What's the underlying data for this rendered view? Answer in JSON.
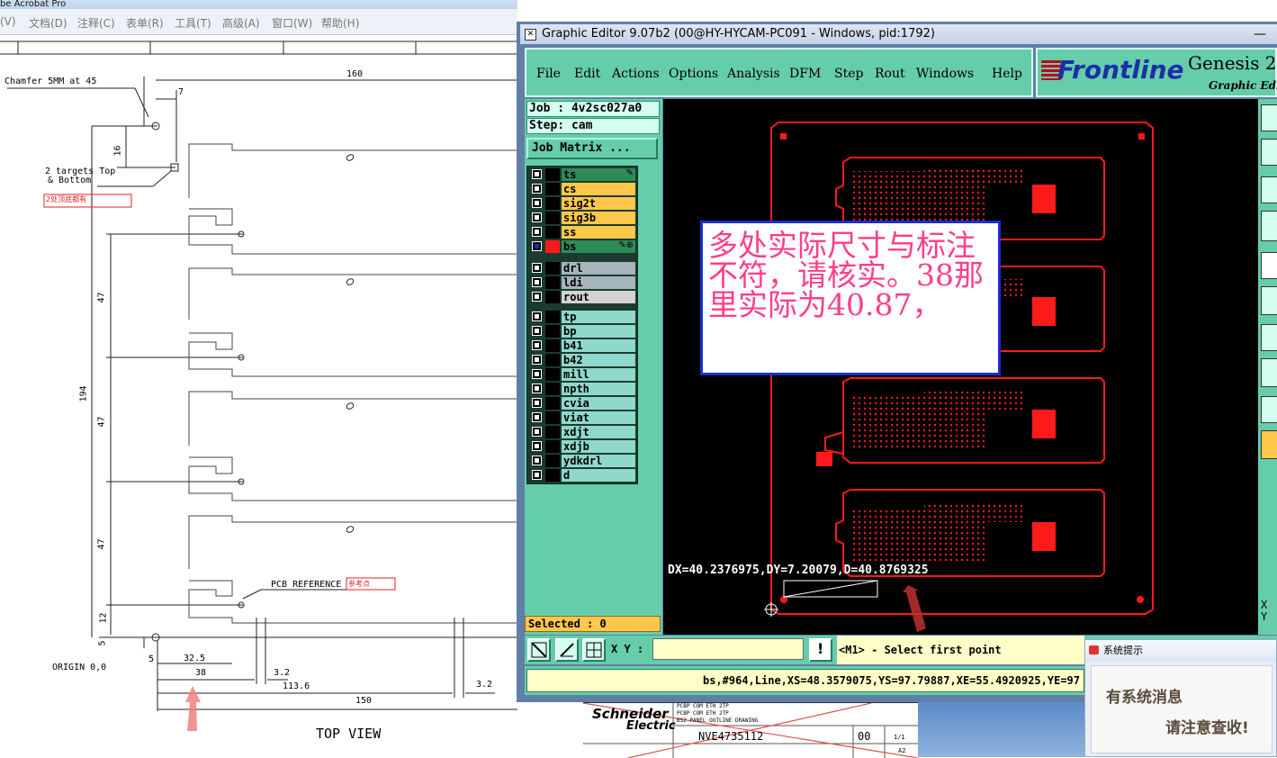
{
  "acrobat": {
    "title": "be Acrobat Pro",
    "menu": [
      "(V)",
      "文档(D)",
      "注释(C)",
      "表单(R)",
      "工具(T)",
      "高级(A)",
      "窗口(W)",
      "帮助(H)"
    ]
  },
  "drawing": {
    "chamfer": "Chamfer 5MM at 45",
    "targets_l1": "2 targets Top",
    "targets_l2": "& Bottom",
    "targets_note": "2处顶底都有",
    "pcb_ref": "PCB REFERENCE",
    "pcb_ref_note": "参考点",
    "origin": "ORIGIN 0,0",
    "top_view": "TOP VIEW",
    "dims": {
      "d160": "160",
      "d7": "7",
      "d16": "16",
      "d47a": "47",
      "d47b": "47",
      "d47c": "47",
      "d194": "194",
      "d12": "12",
      "d5v": "5",
      "d5h": "5",
      "d32_5": "32.5",
      "d38": "38",
      "d3_2a": "3.2",
      "d113_6": "113.6",
      "d3_2b": "3.2",
      "d150": "150"
    }
  },
  "genesis": {
    "title": "Graphic Editor 9.07b2 (00@HY-HYCAM-PC091 - Windows, pid:1792)",
    "menu": [
      "File",
      "Edit",
      "Actions",
      "Options",
      "Analysis",
      "DFM",
      "Step",
      "Rout",
      "Windows",
      "Help"
    ],
    "logo": "Frontline",
    "brand": "Genesis 2",
    "brand_sub": "Graphic Edit",
    "job_label": "Job : 4v2sc027a0",
    "step_label": "Step: cam",
    "job_matrix": "Job Matrix ...",
    "layers_group1": [
      {
        "name": "ts",
        "color": "#2e8b57",
        "mark": "✎"
      },
      {
        "name": "cs",
        "color": "#ffc84a"
      },
      {
        "name": "sig2t",
        "color": "#ffc84a"
      },
      {
        "name": "sig3b",
        "color": "#ffc84a"
      },
      {
        "name": "ss",
        "color": "#ffc84a"
      },
      {
        "name": "bs",
        "color": "#2e8b57",
        "mark": "✎⊕",
        "active": true
      }
    ],
    "layers_group2": [
      {
        "name": "drl",
        "color": "#a6b4bc"
      },
      {
        "name": "ldi",
        "color": "#a6b4bc"
      },
      {
        "name": "rout",
        "color": "#d3d3d3"
      }
    ],
    "layers_group3": [
      "tp",
      "bp",
      "b41",
      "b42",
      "mill",
      "npth",
      "cvia",
      "viat",
      "xdjt",
      "xdjb",
      "ydkdrl",
      "d"
    ],
    "selected": "Selected : 0",
    "xy_label": "X Y :",
    "prompt": "<M1> - Select first point",
    "status": "bs,#964,Line,XS=48.3579075,YS=97.79887,XE=55.4920925,YE=97",
    "measure": "DX=40.2376975,DY=7.20079,D=40.8769325",
    "xy_side": "X\nY"
  },
  "annotation": "多处实际尺寸与标注不符，请核实。38那里实际为40.87，",
  "notification": {
    "title": "系统提示",
    "line1": "有系统消息",
    "line2": "请注意查收!"
  },
  "titleblock": {
    "company1": "Schneider",
    "company2": "Electric",
    "doc_no": "NVE4735112",
    "revision": "00",
    "sheet": "1/1",
    "size": "A2",
    "line1": "PCBP COM ETH 2TP",
    "line2": "PCBP COM ETH 2TP",
    "line3": "BS2-PANEL OUTLINE DRAWING"
  },
  "colors": {
    "genesis_bg": "#66cdaa",
    "canvas": "#000000",
    "board": "#ff1a1a",
    "annotation_text": "#ff3e8a",
    "annotation_border": "#1c2bd6"
  }
}
